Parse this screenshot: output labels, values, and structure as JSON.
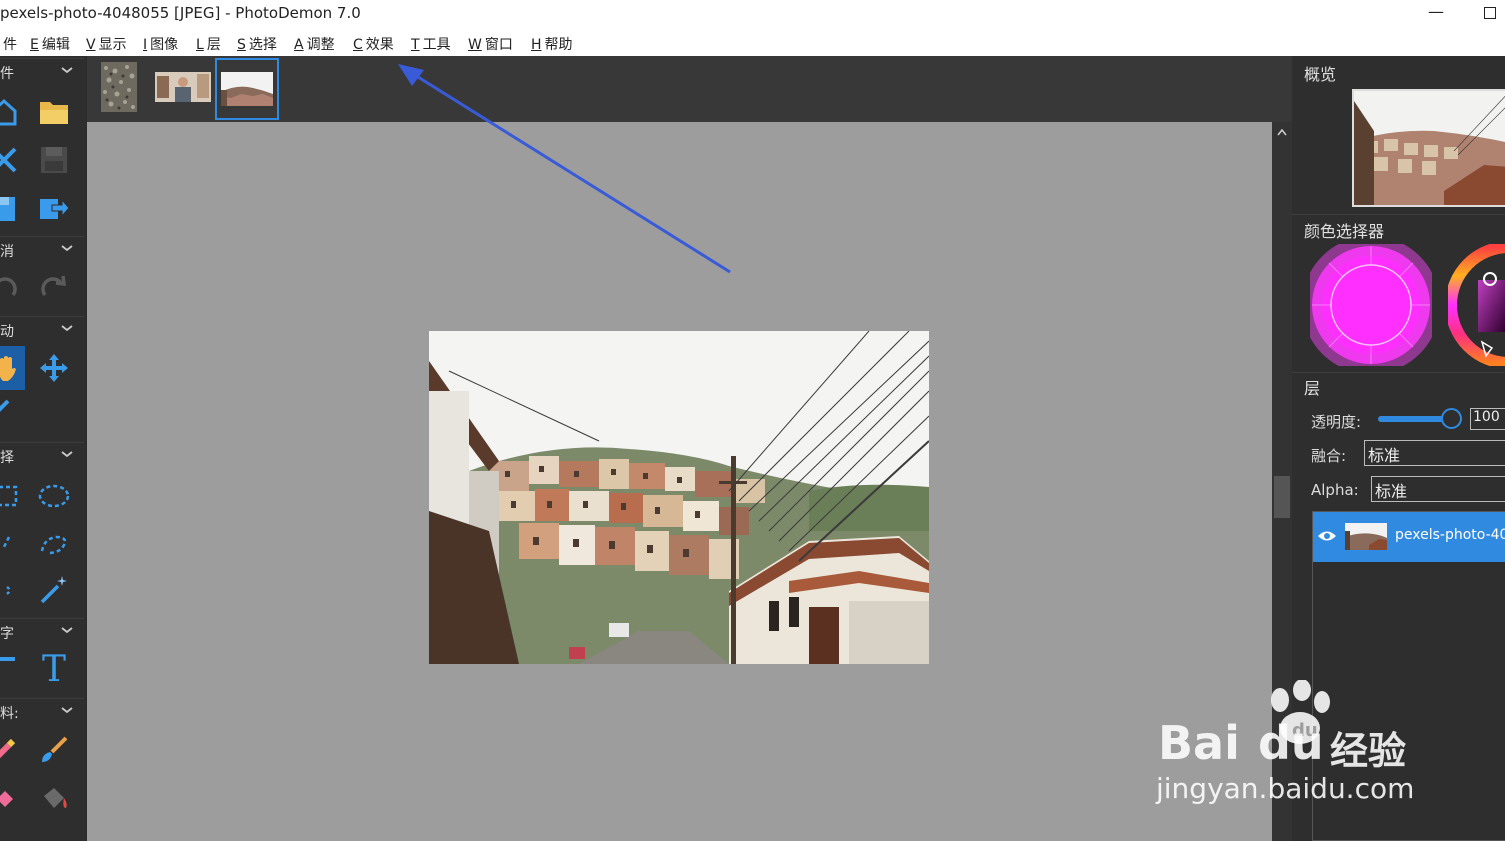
{
  "window": {
    "title": "pexels-photo-4048055 [JPEG]  -  PhotoDemon 7.0",
    "minimize_glyph": "—"
  },
  "menu": [
    {
      "key": "",
      "label": "件"
    },
    {
      "key": "E",
      "label": "编辑"
    },
    {
      "key": "V",
      "label": "显示"
    },
    {
      "key": "I",
      "label": "图像"
    },
    {
      "key": "L",
      "label": "层"
    },
    {
      "key": "S",
      "label": "选择"
    },
    {
      "key": "A",
      "label": "调整"
    },
    {
      "key": "C",
      "label": "效果"
    },
    {
      "key": "T",
      "label": "工具"
    },
    {
      "key": "W",
      "label": "窗口"
    },
    {
      "key": "H",
      "label": "帮助"
    }
  ],
  "toolbox": {
    "sections": [
      {
        "label": "件"
      },
      {
        "label": "消"
      },
      {
        "label": "动"
      },
      {
        "label": "择"
      },
      {
        "label": "字"
      },
      {
        "label": "料:"
      }
    ],
    "text_tool_glyph": "T",
    "icons": [
      "home-icon",
      "folder-open-icon",
      "close-icon",
      "save-icon",
      "save-as-icon",
      "export-icon",
      "undo-icon",
      "redo-icon",
      "hand-icon",
      "move-icon",
      "color-picker-icon",
      "rect-select-icon",
      "ellipse-select-icon",
      "lasso-icon",
      "polygon-lasso-icon",
      "magic-wand-icon",
      "text-tool-icon",
      "eraser-icon",
      "brush-icon",
      "fill-icon"
    ]
  },
  "right_panel": {
    "overview_title": "概览",
    "color_picker_title": "颜色选择器",
    "layers_title": "层",
    "opacity_label": "透明度:",
    "opacity_value": "100",
    "blend_label": "融合:",
    "blend_value": "标准",
    "alpha_label": "Alpha:",
    "alpha_value": "标准",
    "layer_name": "pexels-photo-40",
    "primary_color": "#ff2fff"
  },
  "watermark": {
    "brand": "Bai",
    "brand_tail": "du",
    "cn": "经验",
    "url": "jingyan.baidu.com"
  }
}
